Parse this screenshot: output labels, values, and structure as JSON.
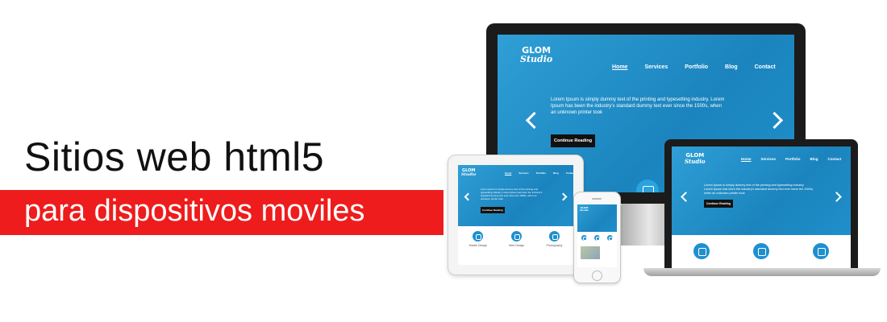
{
  "headline": "Sitios web html5",
  "subheadline": "para dispositivos moviles",
  "colors": {
    "accent_red": "#ee1c1c",
    "site_blue": "#1e90cf",
    "dark": "#111111"
  },
  "site": {
    "logo_line1": "GLOM",
    "logo_line2": "Studio",
    "nav": [
      "Home",
      "Services",
      "Portfolio",
      "Blog",
      "Contact"
    ],
    "hero_text": "Lorem Ipsum is simply dummy text of the printing and typesetting industry. Lorem Ipsum has been the industry's standard dummy text ever since the 1500s, when an unknown printer took",
    "cta_label": "Continue Reading",
    "features": [
      "Mobile Design",
      "Web Design",
      "Photography"
    ]
  },
  "icons": [
    "arrow-left-icon",
    "arrow-right-icon",
    "feature-circle-icon"
  ]
}
